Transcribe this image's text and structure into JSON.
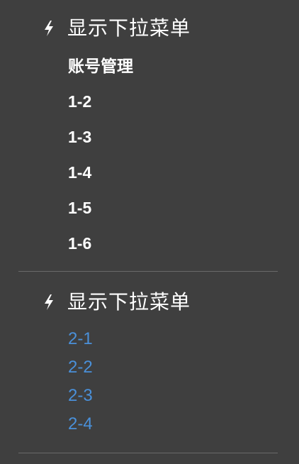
{
  "groups": [
    {
      "title": "显示下拉菜单",
      "icon": "lightning-icon",
      "items": [
        "账号管理",
        "1-2",
        "1-3",
        "1-4",
        "1-5",
        "1-6"
      ],
      "item_color": "#ffffff"
    },
    {
      "title": "显示下拉菜单",
      "icon": "lightning-icon",
      "items": [
        "2-1",
        "2-2",
        "2-3",
        "2-4"
      ],
      "item_color": "#4a90d9"
    }
  ],
  "colors": {
    "background": "#3f3f3f",
    "text": "#ffffff",
    "link": "#4a90d9",
    "divider": "#6a6a6a"
  }
}
